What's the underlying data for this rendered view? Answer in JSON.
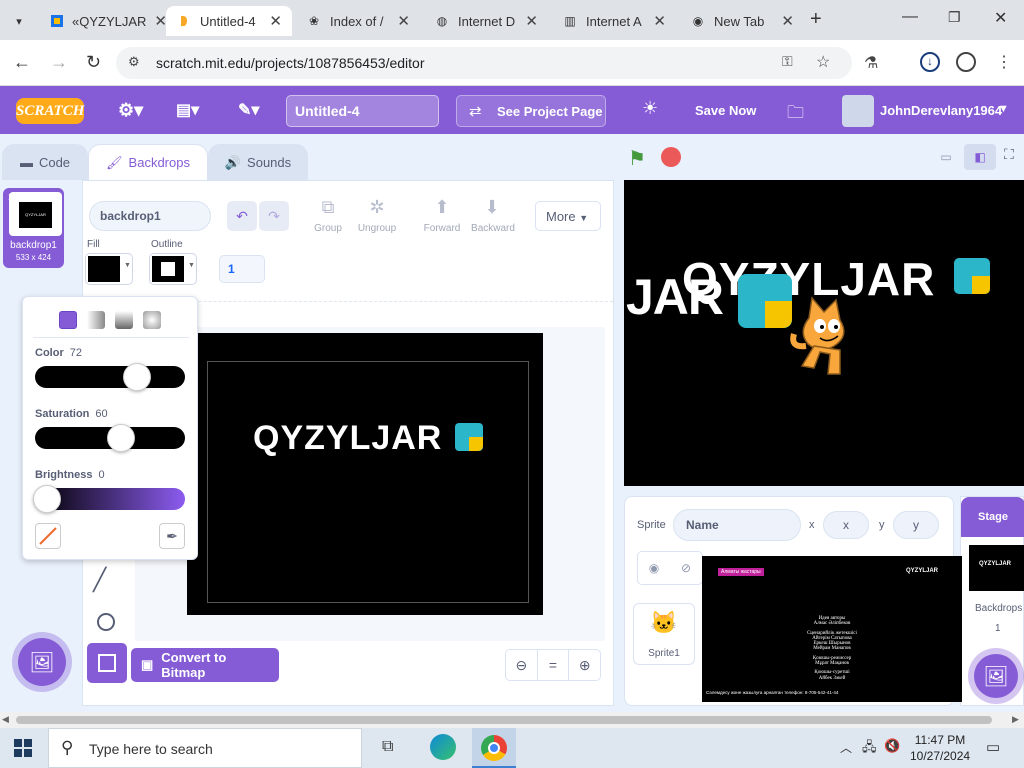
{
  "browser": {
    "tabs": [
      {
        "label": "«QYZYLJAR",
        "icon": "scratch-icon"
      },
      {
        "label": "Untitled-4",
        "icon": "scratch-icon"
      },
      {
        "label": "Index of /",
        "icon": "archive-icon"
      },
      {
        "label": "Internet D",
        "icon": "globe-icon"
      },
      {
        "label": "Internet A",
        "icon": "archive-building-icon"
      },
      {
        "label": "New Tab",
        "icon": "chrome-icon"
      }
    ],
    "url": "scratch.mit.edu/projects/1087856453/editor"
  },
  "menu": {
    "logo": "SCRATCH",
    "project_title": "Untitled-4",
    "see_project_page": "See Project Page",
    "save_now": "Save Now",
    "username": "JohnDerevlany1964"
  },
  "editor_tabs": {
    "code": "Code",
    "backdrops": "Backdrops",
    "sounds": "Sounds"
  },
  "backdrop_list": [
    {
      "index": "1",
      "name": "backdrop1",
      "size": "533 x 424"
    }
  ],
  "paint": {
    "costume_name": "backdrop1",
    "fill_label": "Fill",
    "outline_label": "Outline",
    "outline_width": "1",
    "group": "Group",
    "ungroup": "Ungroup",
    "forward": "Forward",
    "backward": "Backward",
    "more": "More",
    "convert": "Convert to Bitmap",
    "fill_color": "#000000",
    "zoom_reset": "="
  },
  "color_picker": {
    "color_label": "Color",
    "color_value": 72,
    "saturation_label": "Saturation",
    "saturation_value": 60,
    "brightness_label": "Brightness",
    "brightness_value": 0
  },
  "canvas_text": "QYZYLJAR",
  "stage_text": {
    "left": "JAR",
    "right": "QYZYLJAR"
  },
  "sprite_info": {
    "sprite_label": "Sprite",
    "name_placeholder": "Name",
    "x_label": "x",
    "x_value": "x",
    "y_label": "y",
    "y_value": "y"
  },
  "sprites": [
    {
      "name": "Sprite1"
    }
  ],
  "stage_panel": {
    "title": "Stage",
    "backdrops_label": "Backdrops",
    "count": "1"
  },
  "preview_popup": {
    "tag": "Алматы жастары",
    "logo": "QYZYLJAR",
    "credits": [
      "Идея авторы",
      "Алмас Әліпбеков",
      "Сценарийлік жетекшісі",
      "Айгерім Сатыпова",
      "Еркеш Шырынов",
      "Мейрам Манапов",
      "Қоюшы-режиссер",
      "Мұрат Мақанов",
      "Қоюшы-суретші",
      "Айбек Зәкей"
    ],
    "footer": "Сәлемдесу және жазылуға арналған телефон: 8-705-542-41-44"
  },
  "taskbar": {
    "search_placeholder": "Type here to search",
    "time": "11:47 PM",
    "date": "10/27/2024"
  }
}
